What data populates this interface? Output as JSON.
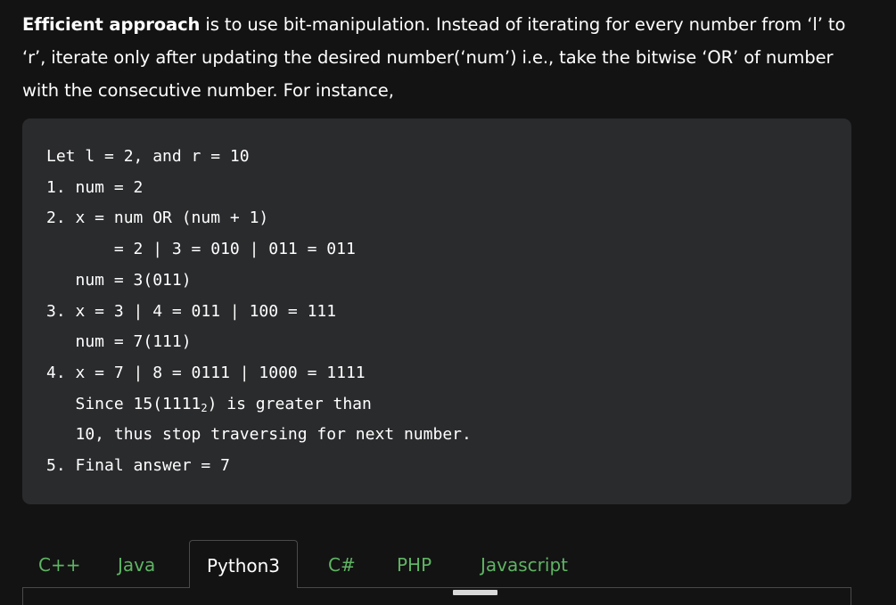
{
  "intro": {
    "bold": "Efficient approach",
    "rest": " is to use bit-manipulation. Instead of iterating for every number from ‘l’ to ‘r’, iterate only after updating the desired number(‘num’) i.e., take the bitwise ‘OR’ of number with the consecutive number. For instance,"
  },
  "code": {
    "lines": [
      "Let l = 2, and r = 10",
      "1. num = 2",
      "2. x = num OR (num + 1)",
      "       = 2 | 3 = 010 | 011 = 011",
      "   num = 3(011)",
      "3. x = 3 | 4 = 011 | 100 = 111",
      "   num = 7(111)",
      "4. x = 7 | 8 = 0111 | 1000 = 1111",
      "   Since 15(1111",
      "2",
      ") is greater than",
      "   10, thus stop traversing for next number.",
      "5. Final answer = 7"
    ]
  },
  "tabs": [
    {
      "label": "C++"
    },
    {
      "label": "Java"
    },
    {
      "label": "Python3",
      "active": true
    },
    {
      "label": "C#"
    },
    {
      "label": "PHP"
    },
    {
      "label": "Javascript"
    }
  ]
}
